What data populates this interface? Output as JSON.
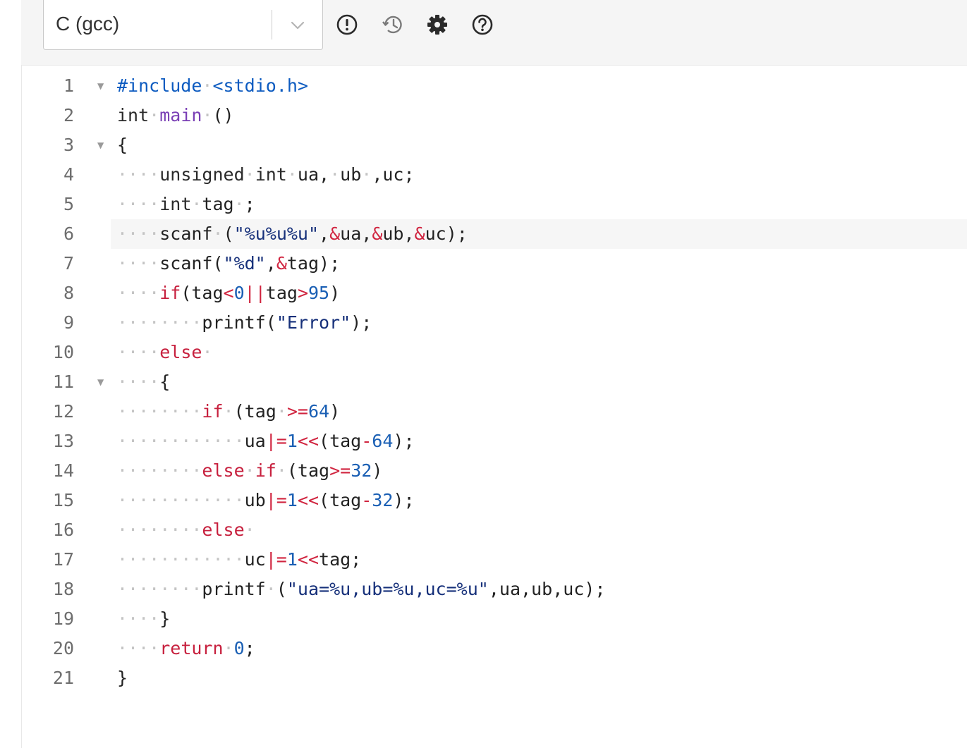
{
  "toolbar": {
    "language": "C (gcc)",
    "icons": [
      "exclamation-circle-icon",
      "history-icon",
      "gear-icon",
      "help-icon"
    ]
  },
  "colors": {
    "keyword": "#c7203e",
    "function": "#7a3fb5",
    "string": "#16307a",
    "number": "#1a5fb4",
    "preprocessor": "#0d5bc0",
    "whitespace_dot": "#c4c4c4",
    "line_number": "#6e6e6e"
  },
  "editor": {
    "active_line": 6,
    "lines": [
      {
        "n": "1",
        "fold": true,
        "tokens": [
          [
            "pre",
            "#include"
          ],
          [
            "ws",
            "·"
          ],
          [
            "pre",
            "<stdio.h>"
          ]
        ]
      },
      {
        "n": "2",
        "tokens": [
          [
            "ty",
            "int"
          ],
          [
            "ws",
            "·"
          ],
          [
            "fn",
            "main"
          ],
          [
            "ws",
            "·"
          ],
          [
            "pl",
            "()"
          ]
        ]
      },
      {
        "n": "3",
        "fold": true,
        "tokens": [
          [
            "pl",
            "{"
          ]
        ]
      },
      {
        "n": "4",
        "tokens": [
          [
            "ws",
            "····"
          ],
          [
            "ty",
            "unsigned"
          ],
          [
            "ws",
            "·"
          ],
          [
            "ty",
            "int"
          ],
          [
            "ws",
            "·"
          ],
          [
            "pl",
            "ua,"
          ],
          [
            "ws",
            "·"
          ],
          [
            "pl",
            "ub"
          ],
          [
            "ws",
            "·"
          ],
          [
            "pl",
            ",uc;"
          ]
        ]
      },
      {
        "n": "5",
        "tokens": [
          [
            "ws",
            "····"
          ],
          [
            "ty",
            "int"
          ],
          [
            "ws",
            "·"
          ],
          [
            "pl",
            "tag"
          ],
          [
            "ws",
            "·"
          ],
          [
            "pl",
            ";"
          ]
        ]
      },
      {
        "n": "6",
        "tokens": [
          [
            "ws",
            "····"
          ],
          [
            "pl",
            "scanf"
          ],
          [
            "ws",
            "·"
          ],
          [
            "pl",
            "("
          ],
          [
            "str",
            "\"%u%u%u\""
          ],
          [
            "pl",
            ","
          ],
          [
            "op",
            "&"
          ],
          [
            "pl",
            "ua,"
          ],
          [
            "op",
            "&"
          ],
          [
            "pl",
            "ub,"
          ],
          [
            "op",
            "&"
          ],
          [
            "pl",
            "uc);"
          ]
        ]
      },
      {
        "n": "7",
        "tokens": [
          [
            "ws",
            "····"
          ],
          [
            "pl",
            "scanf("
          ],
          [
            "str",
            "\"%d\""
          ],
          [
            "pl",
            ","
          ],
          [
            "op",
            "&"
          ],
          [
            "pl",
            "tag);"
          ]
        ]
      },
      {
        "n": "8",
        "tokens": [
          [
            "ws",
            "····"
          ],
          [
            "kw",
            "if"
          ],
          [
            "pl",
            "(tag"
          ],
          [
            "op",
            "<"
          ],
          [
            "num",
            "0"
          ],
          [
            "op",
            "||"
          ],
          [
            "pl",
            "tag"
          ],
          [
            "op",
            ">"
          ],
          [
            "num",
            "95"
          ],
          [
            "pl",
            ")"
          ]
        ]
      },
      {
        "n": "9",
        "tokens": [
          [
            "ws",
            "········"
          ],
          [
            "pl",
            "printf("
          ],
          [
            "str",
            "\"Error\""
          ],
          [
            "pl",
            ");"
          ]
        ]
      },
      {
        "n": "10",
        "tokens": [
          [
            "ws",
            "····"
          ],
          [
            "kw",
            "else"
          ],
          [
            "ws",
            "·"
          ]
        ]
      },
      {
        "n": "11",
        "fold": true,
        "tokens": [
          [
            "ws",
            "····"
          ],
          [
            "pl",
            "{"
          ]
        ]
      },
      {
        "n": "12",
        "tokens": [
          [
            "ws",
            "········"
          ],
          [
            "kw",
            "if"
          ],
          [
            "ws",
            "·"
          ],
          [
            "pl",
            "(tag"
          ],
          [
            "ws",
            "·"
          ],
          [
            "op",
            ">="
          ],
          [
            "num",
            "64"
          ],
          [
            "pl",
            ")"
          ]
        ]
      },
      {
        "n": "13",
        "tokens": [
          [
            "ws",
            "············"
          ],
          [
            "pl",
            "ua"
          ],
          [
            "op",
            "|="
          ],
          [
            "num",
            "1"
          ],
          [
            "op",
            "<<"
          ],
          [
            "pl",
            "(tag"
          ],
          [
            "op",
            "-"
          ],
          [
            "num",
            "64"
          ],
          [
            "pl",
            ");"
          ]
        ]
      },
      {
        "n": "14",
        "tokens": [
          [
            "ws",
            "········"
          ],
          [
            "kw",
            "else"
          ],
          [
            "ws",
            "·"
          ],
          [
            "kw",
            "if"
          ],
          [
            "ws",
            "·"
          ],
          [
            "pl",
            "(tag"
          ],
          [
            "op",
            ">="
          ],
          [
            "num",
            "32"
          ],
          [
            "pl",
            ")"
          ]
        ]
      },
      {
        "n": "15",
        "tokens": [
          [
            "ws",
            "············"
          ],
          [
            "pl",
            "ub"
          ],
          [
            "op",
            "|="
          ],
          [
            "num",
            "1"
          ],
          [
            "op",
            "<<"
          ],
          [
            "pl",
            "(tag"
          ],
          [
            "op",
            "-"
          ],
          [
            "num",
            "32"
          ],
          [
            "pl",
            ");"
          ]
        ]
      },
      {
        "n": "16",
        "tokens": [
          [
            "ws",
            "········"
          ],
          [
            "kw",
            "else"
          ],
          [
            "ws",
            "·"
          ]
        ]
      },
      {
        "n": "17",
        "tokens": [
          [
            "ws",
            "············"
          ],
          [
            "pl",
            "uc"
          ],
          [
            "op",
            "|="
          ],
          [
            "num",
            "1"
          ],
          [
            "op",
            "<<"
          ],
          [
            "pl",
            "tag;"
          ]
        ]
      },
      {
        "n": "18",
        "tokens": [
          [
            "ws",
            "········"
          ],
          [
            "pl",
            "printf"
          ],
          [
            "ws",
            "·"
          ],
          [
            "pl",
            "("
          ],
          [
            "str",
            "\"ua=%u,ub=%u,uc=%u\""
          ],
          [
            "pl",
            ",ua,ub,uc);"
          ]
        ]
      },
      {
        "n": "19",
        "tokens": [
          [
            "ws",
            "····"
          ],
          [
            "pl",
            "}"
          ]
        ]
      },
      {
        "n": "20",
        "tokens": [
          [
            "ws",
            "····"
          ],
          [
            "kw",
            "return"
          ],
          [
            "ws",
            "·"
          ],
          [
            "num",
            "0"
          ],
          [
            "pl",
            ";"
          ]
        ]
      },
      {
        "n": "21",
        "tokens": [
          [
            "pl",
            "}"
          ]
        ]
      }
    ]
  }
}
